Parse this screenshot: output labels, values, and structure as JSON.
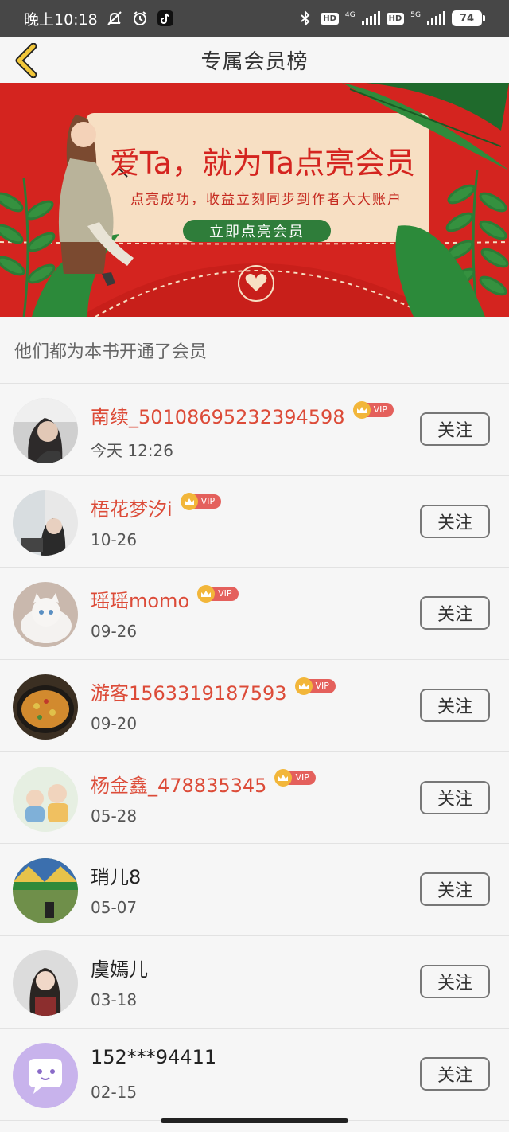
{
  "status_bar": {
    "time": "晚上10:18",
    "hd1": "HD",
    "net1": "4G",
    "hd2": "HD",
    "net2": "5G",
    "battery": "74"
  },
  "header": {
    "title": "专属会员榜"
  },
  "banner": {
    "headline": "爱Ta，就为Ta点亮会员",
    "subtitle": "点亮成功，收益立刻同步到作者大大账户",
    "cta_label": "立即点亮会员",
    "colors": {
      "background": "#d4241f",
      "card": "#f7dfc3",
      "button": "#2f7d3a"
    }
  },
  "section": {
    "title": "他们都为本书开通了会员"
  },
  "members": [
    {
      "name": "南续_50108695232394598",
      "date": "今天 12:26",
      "vip": true,
      "vip_label": "VIP",
      "follow_label": "关注",
      "avatar": "woman-portrait"
    },
    {
      "name": "梧花梦汐i",
      "date": "10-26",
      "vip": true,
      "vip_label": "VIP",
      "follow_label": "关注",
      "avatar": "girl-photo"
    },
    {
      "name": "瑶瑶momo",
      "date": "09-26",
      "vip": true,
      "vip_label": "VIP",
      "follow_label": "关注",
      "avatar": "white-cat"
    },
    {
      "name": "游客1563319187593",
      "date": "09-20",
      "vip": true,
      "vip_label": "VIP",
      "follow_label": "关注",
      "avatar": "paella-dish"
    },
    {
      "name": "杨金鑫_478835345",
      "date": "05-28",
      "vip": true,
      "vip_label": "VIP",
      "follow_label": "关注",
      "avatar": "babies"
    },
    {
      "name": "琑儿8",
      "date": "05-07",
      "vip": false,
      "vip_label": "",
      "follow_label": "关注",
      "avatar": "colorful-tent"
    },
    {
      "name": "虞嫣儿",
      "date": "03-18",
      "vip": false,
      "vip_label": "",
      "follow_label": "关注",
      "avatar": "girl-selfie"
    },
    {
      "name": "152***94411",
      "date": "02-15",
      "vip": false,
      "vip_label": "",
      "follow_label": "关注",
      "avatar": "default-chat-bubble"
    }
  ],
  "colors": {
    "vip_name": "#dc4b38",
    "accent": "#d4241f"
  }
}
